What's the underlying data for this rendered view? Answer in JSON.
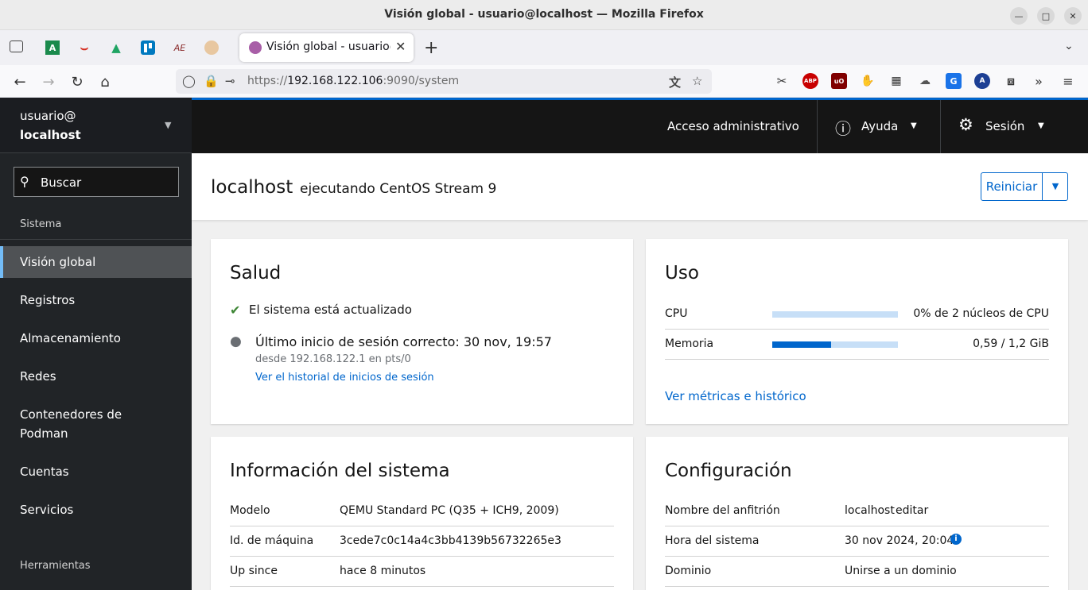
{
  "window": {
    "title": "Visión global - usuario@localhost — Mozilla Firefox"
  },
  "browser": {
    "tab_label": "Visión global - usuario@localhost",
    "url_prefix": "https://",
    "url_host": "192.168.122.106",
    "url_path": ":9090/system",
    "pinned_icons": [
      "tab-overview-icon",
      "a-green-icon",
      "red-arcs-icon",
      "google-drive-icon",
      "trello-icon",
      "ae-icon",
      "avatar-icon"
    ],
    "extension_icons": [
      "screenshot-icon",
      "adblock-plus-icon",
      "ublock-origin-icon",
      "hand-icon",
      "fence-icon",
      "cloud-icon",
      "translate-icon",
      "circle-badge-icon",
      "puzzle-icon"
    ],
    "abp_text": "ABP",
    "ublock_text": "uO"
  },
  "sidebar": {
    "user": "usuario@",
    "host": "localhost",
    "search_placeholder": "Buscar",
    "section_system": "Sistema",
    "items": [
      {
        "label": "Visión global"
      },
      {
        "label": "Registros"
      },
      {
        "label": "Almacenamiento"
      },
      {
        "label": "Redes"
      },
      {
        "label": "Contenedores de Podman"
      },
      {
        "label": "Cuentas"
      },
      {
        "label": "Servicios"
      }
    ],
    "section_tools": "Herramientas"
  },
  "masthead": {
    "admin_access": "Acceso administrativo",
    "help": "Ayuda",
    "session": "Sesión"
  },
  "page": {
    "hostname": "localhost",
    "running": "ejecutando CentOS Stream 9",
    "restart_button": "Reiniciar"
  },
  "health": {
    "title": "Salud",
    "updated": "El sistema está actualizado",
    "last_login": "Último inicio de sesión correcto: 30 nov, 19:57",
    "login_from": "desde 192.168.122.1 en pts/0",
    "history_link": "Ver el historial de inicios de sesión"
  },
  "usage": {
    "title": "Uso",
    "cpu_label": "CPU",
    "cpu_fraction": 0.0,
    "cpu_value": "0% de 2 núcleos de CPU",
    "mem_label": "Memoria",
    "mem_fraction": 0.47,
    "mem_value": "0,59 / 1,2 GiB",
    "metrics_link": "Ver métricas e histórico"
  },
  "system_info": {
    "title": "Información del sistema",
    "rows": [
      {
        "label": "Modelo",
        "value": "QEMU Standard PC (Q35 + ICH9, 2009)"
      },
      {
        "label": "Id. de máquina",
        "value": "3cede7c0c14a4c3bb4139b56732265e3"
      },
      {
        "label": "Up since",
        "value": "hace 8 minutos"
      }
    ]
  },
  "config": {
    "title": "Configuración",
    "hostname_label": "Nombre del anfitrión",
    "hostname_value": "localhost",
    "hostname_edit": "editar",
    "time_label": "Hora del sistema",
    "time_value": "30 nov 2024, 20:04",
    "domain_label": "Dominio",
    "domain_value": "Unirse a un dominio"
  },
  "colors": {
    "accent": "#0066cc",
    "success": "#3e8635",
    "sidebar_bg": "#212427",
    "masthead_bg": "#151515"
  }
}
